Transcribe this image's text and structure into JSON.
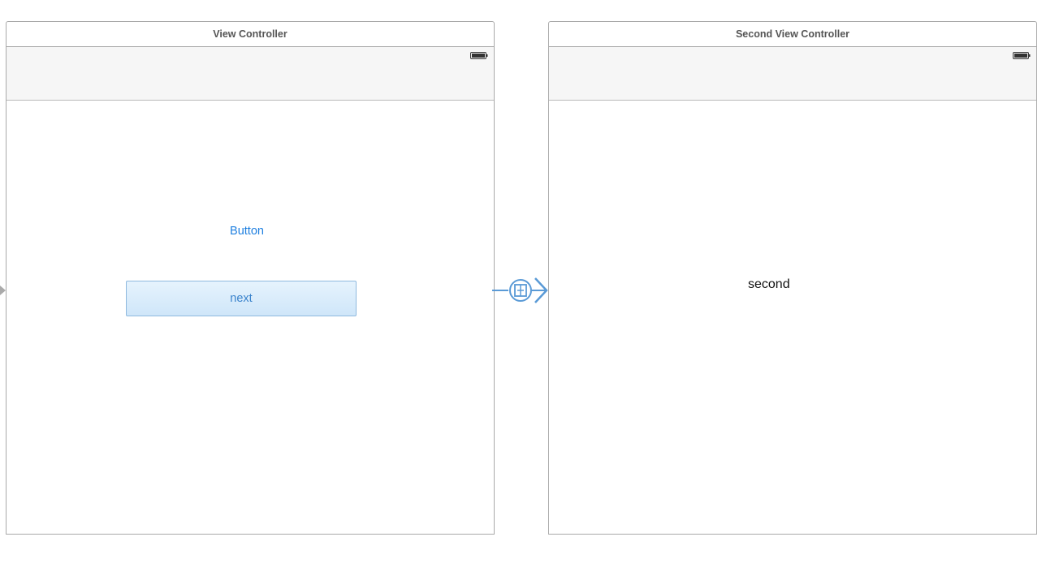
{
  "scenes": {
    "first": {
      "title": "View Controller",
      "button_label": "Button",
      "next_label": "next"
    },
    "second": {
      "title": "Second View Controller",
      "label_text": "second"
    }
  },
  "icons": {
    "battery": "battery-icon",
    "segue": "segue-icon",
    "entry": "initial-controller-arrow-icon"
  },
  "colors": {
    "accent": "#1e7fe0",
    "segue": "#5a9ad6"
  }
}
